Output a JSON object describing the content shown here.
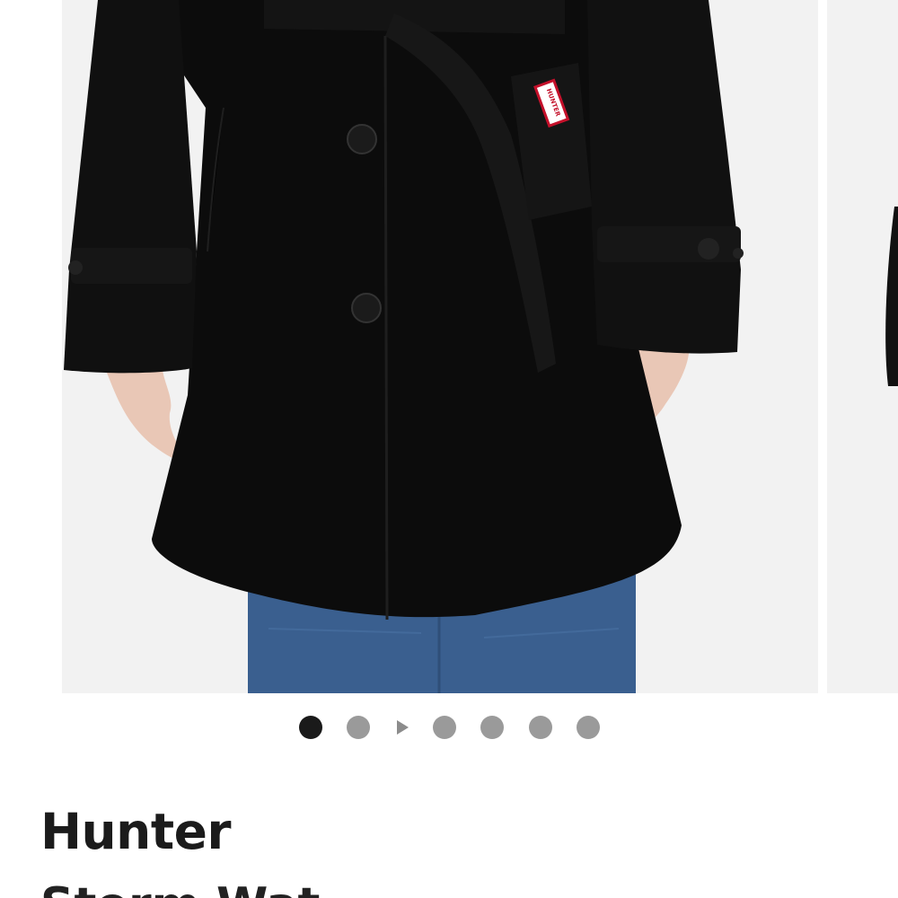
{
  "product": {
    "brand": "Hunter",
    "title": "Storm Wat",
    "label_text": "HUNTER"
  },
  "gallery": {
    "slide_count": 7,
    "active_index": 0,
    "dots": [
      {
        "kind": "image",
        "active": true
      },
      {
        "kind": "image",
        "active": false
      },
      {
        "kind": "video",
        "active": false
      },
      {
        "kind": "image",
        "active": false
      },
      {
        "kind": "image",
        "active": false
      },
      {
        "kind": "image",
        "active": false
      },
      {
        "kind": "image",
        "active": false
      }
    ]
  },
  "colors": {
    "coat": "#0c0c0c",
    "denim": "#3a5f8f",
    "backdrop": "#f2f2f2",
    "label_red": "#c4102a",
    "dot_active": "#1a1a1a",
    "dot_inactive": "#9a9a9a"
  }
}
